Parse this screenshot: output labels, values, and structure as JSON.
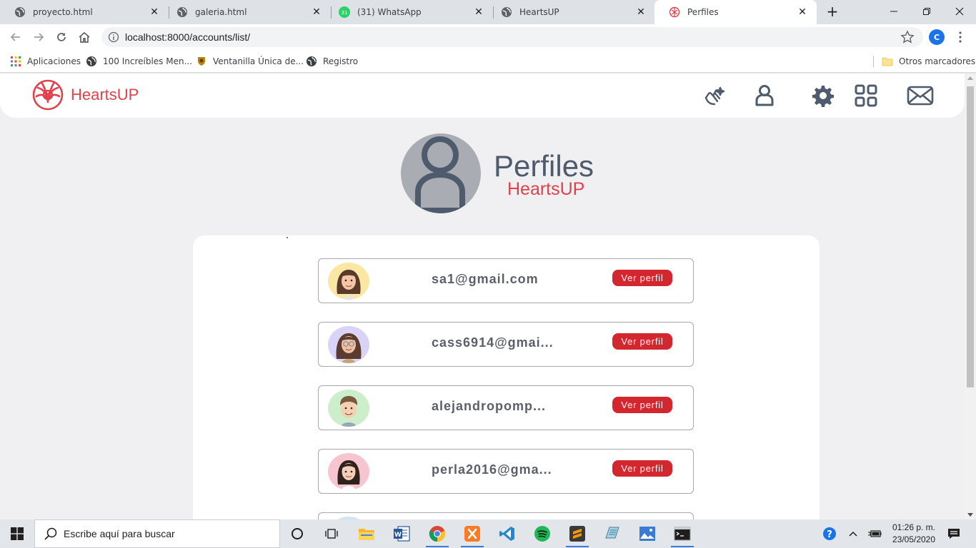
{
  "browser": {
    "tabs": [
      {
        "title": "proyecto.html",
        "icon": "globe-icon",
        "active": false
      },
      {
        "title": "galeria.html",
        "icon": "globe-icon",
        "active": false
      },
      {
        "title": "(31) WhatsApp",
        "icon": "whatsapp-icon",
        "badge": "31",
        "active": false
      },
      {
        "title": "HeartsUP",
        "icon": "globe-icon",
        "active": false
      },
      {
        "title": "Perfiles",
        "icon": "heartsup-logo-icon",
        "active": true
      }
    ],
    "url": "localhost:8000/accounts/list/",
    "profile_initial": "C",
    "bookmarks": [
      {
        "label": "Aplicaciones",
        "icon": "apps-grid-icon"
      },
      {
        "label": "100 Increíbles Men...",
        "icon": "globe-icon"
      },
      {
        "label": "Ventanilla Única de...",
        "icon": "crest-icon"
      },
      {
        "label": "Registro",
        "icon": "globe-icon"
      }
    ],
    "other_bookmarks": "Otros marcadores"
  },
  "site": {
    "brand": "HeartsUP",
    "accent": "#e2414b",
    "hero_title": "Perfiles",
    "hero_subtitle": "HeartsUP",
    "ver_perfil_label": "Ver perfil",
    "profiles": [
      {
        "email": "sa1@gmail.com",
        "avatar_bg": "#fbe7a4",
        "hair": "#5a3a2a",
        "skin": "#f2c6a6"
      },
      {
        "email": "cass6914@gmai...",
        "avatar_bg": "#d9d4f7",
        "hair": "#5b3b30",
        "skin": "#efc09f"
      },
      {
        "email": "alejandropomp...",
        "avatar_bg": "#cdeecb",
        "hair": "#7a5a3e",
        "skin": "#f4cfb0"
      },
      {
        "email": "perla2016@gma...",
        "avatar_bg": "#f7c5cf",
        "hair": "#2f211c",
        "skin": "#f4d0b8"
      }
    ]
  },
  "taskbar": {
    "search_placeholder": "Escribe aquí para buscar",
    "time": "01:26 p. m.",
    "date": "23/05/2020"
  }
}
